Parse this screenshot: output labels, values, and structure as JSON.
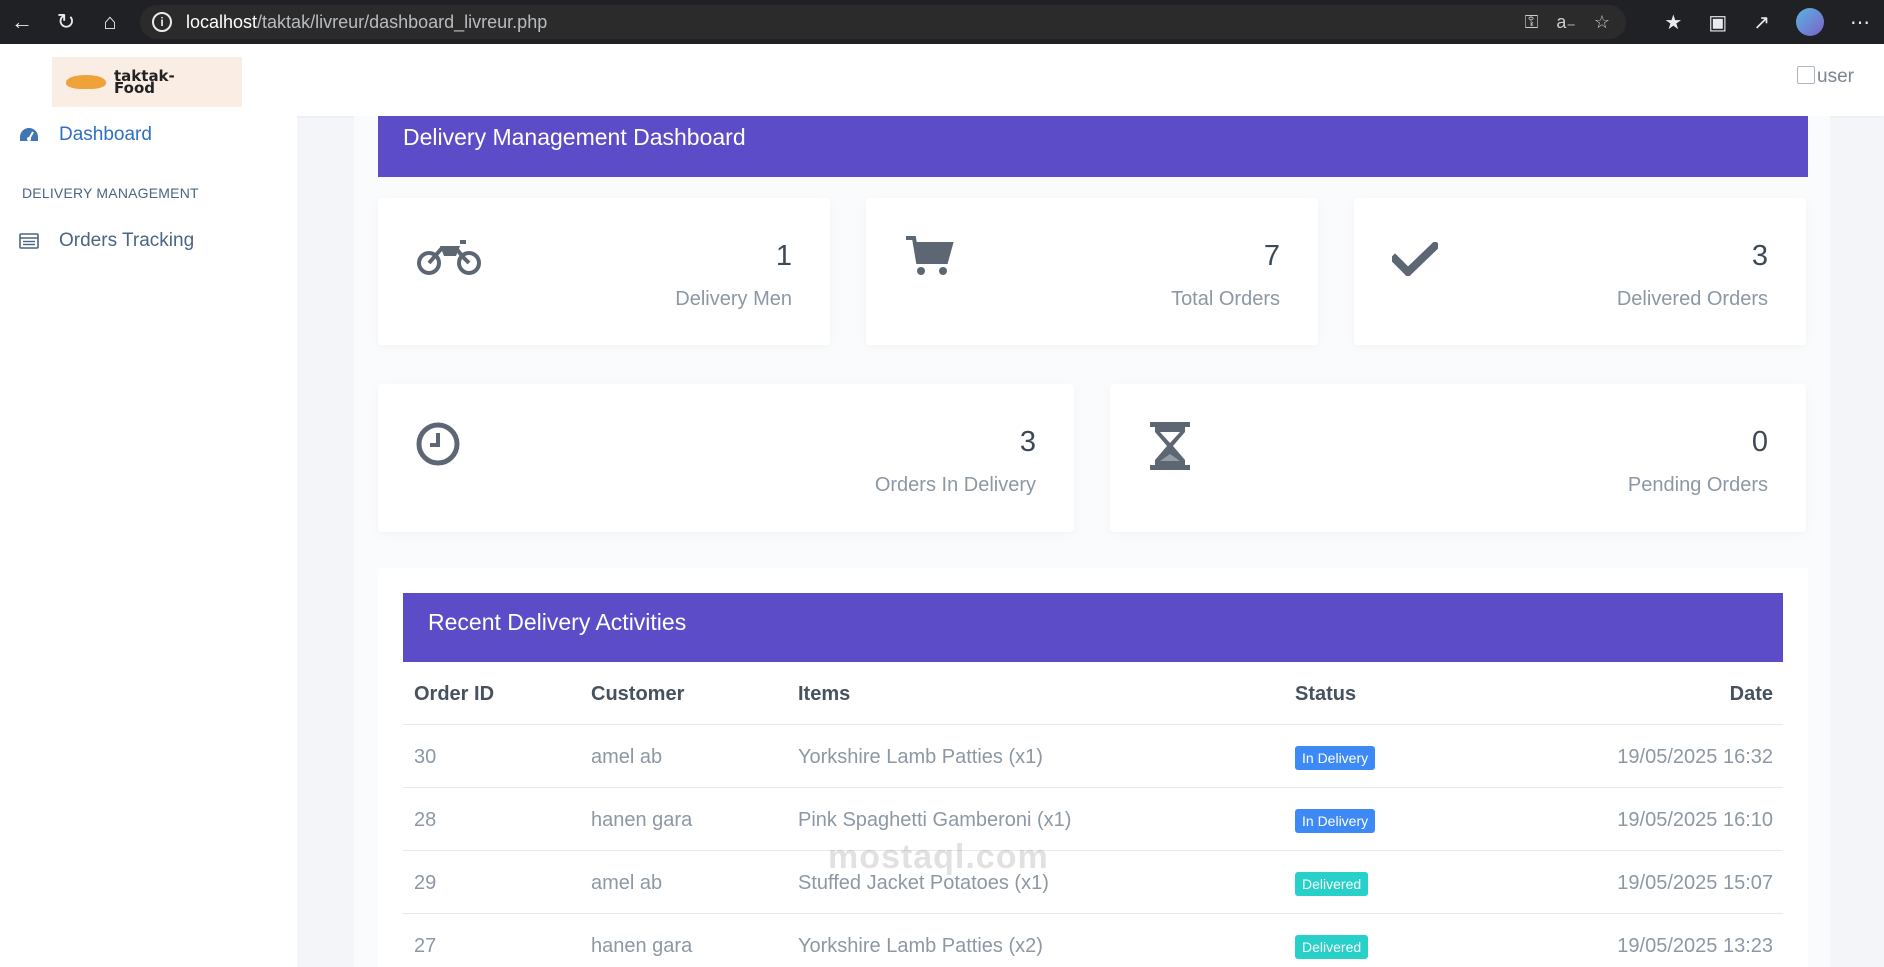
{
  "browser": {
    "url_host": "localhost",
    "url_path": "/taktak/livreur/dashboard_livreur.php"
  },
  "header": {
    "logo_text_1": "taktak-",
    "logo_text_2": "Food",
    "user_alt": "user"
  },
  "sidebar": {
    "dashboard_label": "Dashboard",
    "section_heading": "DELIVERY MANAGEMENT",
    "orders_label": "Orders Tracking"
  },
  "main": {
    "page_title": "Delivery Management Dashboard",
    "stats": [
      {
        "value": "1",
        "label": "Delivery Men",
        "icon": "motorcycle-icon"
      },
      {
        "value": "7",
        "label": "Total Orders",
        "icon": "cart-icon"
      },
      {
        "value": "3",
        "label": "Delivered Orders",
        "icon": "check-icon"
      },
      {
        "value": "3",
        "label": "Orders In Delivery",
        "icon": "clock-icon"
      },
      {
        "value": "0",
        "label": "Pending Orders",
        "icon": "hourglass-icon"
      }
    ],
    "activities_title": "Recent Delivery Activities",
    "columns": [
      "Order ID",
      "Customer",
      "Items",
      "Status",
      "Date"
    ],
    "rows": [
      {
        "id": "30",
        "customer": "amel ab",
        "items": "Yorkshire Lamb Patties (x1)",
        "status": "In Delivery",
        "date": "19/05/2025 16:32"
      },
      {
        "id": "28",
        "customer": "hanen gara",
        "items": "Pink Spaghetti Gamberoni (x1)",
        "status": "In Delivery",
        "date": "19/05/2025 16:10"
      },
      {
        "id": "29",
        "customer": "amel ab",
        "items": "Stuffed Jacket Potatoes (x1)",
        "status": "Delivered",
        "date": "19/05/2025 15:07"
      },
      {
        "id": "27",
        "customer": "hanen gara",
        "items": "Yorkshire Lamb Patties (x2)",
        "status": "Delivered",
        "date": "19/05/2025 13:23"
      }
    ]
  },
  "watermark": "mostaql.com",
  "colors": {
    "accent": "#5d4cc7",
    "badge_in_delivery": "#3d8af7",
    "badge_delivered": "#27d0c9"
  }
}
